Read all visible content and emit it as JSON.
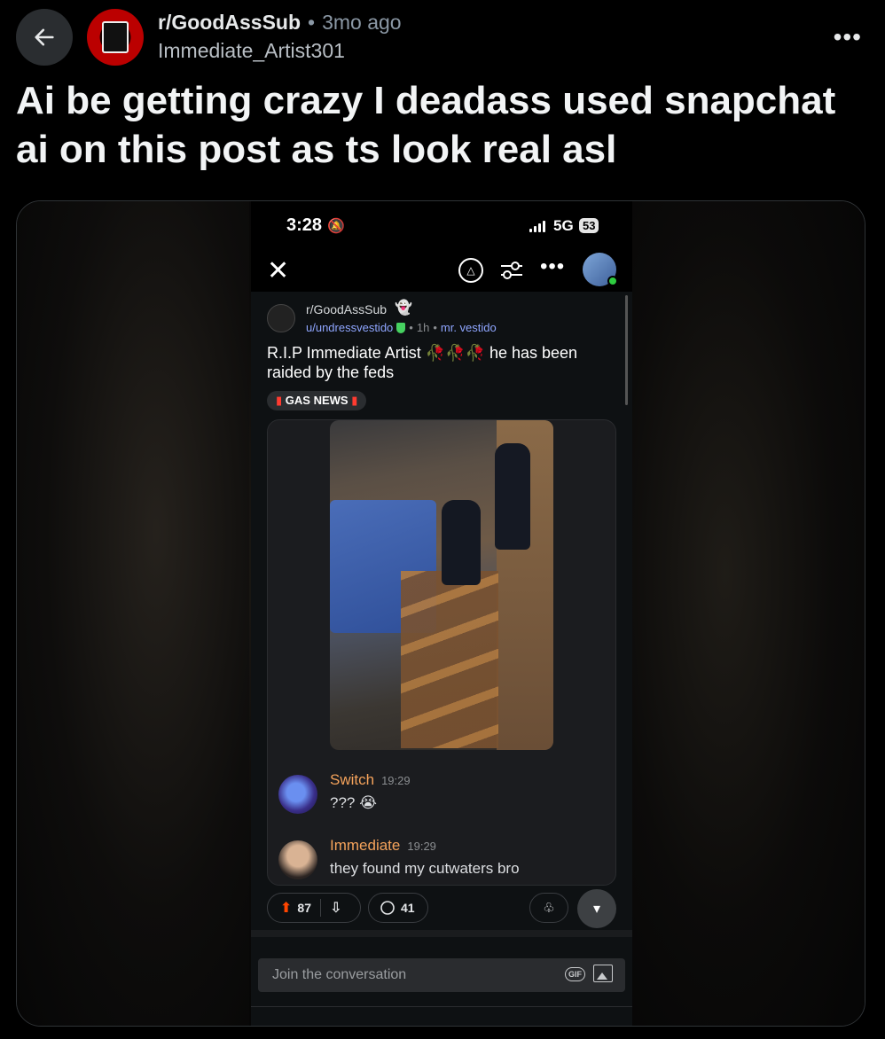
{
  "post": {
    "subreddit": "r/GoodAssSub",
    "separator": "•",
    "age": "3mo ago",
    "author": "Immediate_Artist301",
    "title": "Ai be getting crazy I deadass used snapchat ai on this post as ts look real asl"
  },
  "icons": {
    "back": "arrow-left-icon",
    "more": "more-horizontal-icon"
  },
  "screenshot": {
    "status_bar": {
      "time": "3:28",
      "network": "5G",
      "battery": "53"
    },
    "inner_post": {
      "subreddit": "r/GoodAssSub",
      "user": "u/undressvestido",
      "age": "1h",
      "flair_user": "mr. vestido",
      "title": "R.I.P Immediate Artist 🥀🥀🥀 he has been raided by the feds",
      "post_flair": "GAS NEWS"
    },
    "messages": [
      {
        "name": "Switch",
        "time": "19:29",
        "text": "??? 😭"
      },
      {
        "name": "Immediate",
        "time": "19:29",
        "text": "they found my cutwaters bro"
      }
    ],
    "actions": {
      "upvotes": "87",
      "comments": "41"
    },
    "composer": {
      "placeholder": "Join the conversation",
      "gif_label": "GIF"
    }
  }
}
